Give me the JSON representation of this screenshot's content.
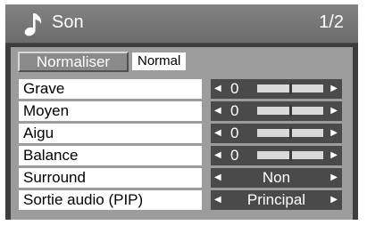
{
  "header": {
    "title": "Son",
    "page": "1/2"
  },
  "normaliser": {
    "label": "Normaliser",
    "value": "Normal"
  },
  "rows": [
    {
      "label": "Grave",
      "value": "0",
      "level": 0.5
    },
    {
      "label": "Moyen",
      "value": "0",
      "level": 0.5
    },
    {
      "label": "Aigu",
      "value": "0",
      "level": 0.5
    },
    {
      "label": "Balance",
      "value": "0",
      "level": 0.5
    },
    {
      "label": "Surround",
      "option": "Non"
    },
    {
      "label": "Sortie audio (PIP)",
      "option": "Principal"
    }
  ],
  "icons": {
    "header": "music-note-icon",
    "left": "arrow-left-icon",
    "right": "arrow-right-icon"
  },
  "colors": {
    "panel": "#9c9c9c",
    "header": "#767676",
    "frame": "#3d3d3d"
  }
}
